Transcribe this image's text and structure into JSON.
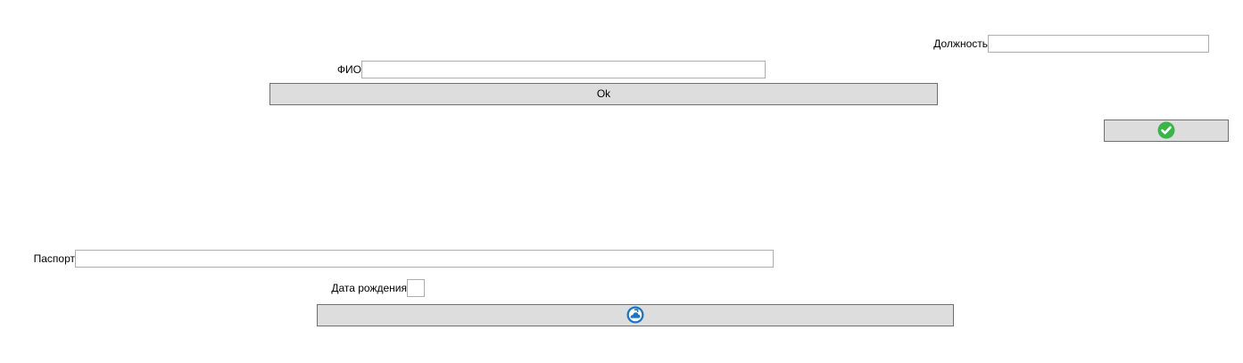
{
  "form": {
    "position": {
      "label": "Должность",
      "value": ""
    },
    "fio": {
      "label": "ФИО",
      "value": ""
    },
    "ok_button": {
      "label": "Ok"
    },
    "confirm_button": {
      "icon": "check-circle-icon",
      "icon_color": "#3bb54a"
    },
    "passport": {
      "label": "Паспорт",
      "value": ""
    },
    "birth_date": {
      "label": "Дата рождения",
      "value": ""
    },
    "refresh_button": {
      "icon": "refresh-cloud-icon",
      "icon_color": "#1e73be"
    }
  },
  "colors": {
    "button_bg": "#dddddd",
    "button_border": "#707070",
    "field_border": "#adadad"
  }
}
